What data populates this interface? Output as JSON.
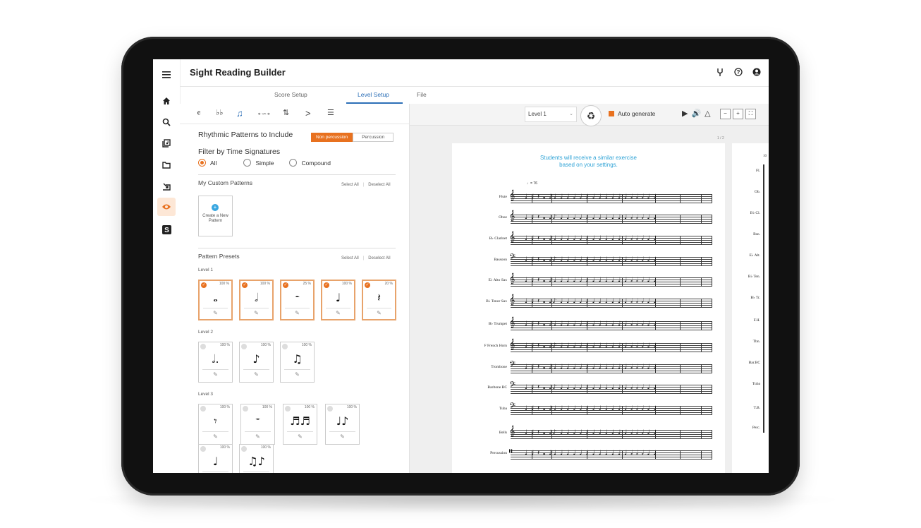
{
  "app": {
    "title": "Sight Reading Builder"
  },
  "rail": {
    "icons": [
      "menu-icon",
      "home-icon",
      "search-icon",
      "library-icon",
      "folder-icon",
      "assign-icon",
      "eye-icon",
      "s-logo-icon"
    ]
  },
  "header": {
    "icons": [
      "tuning-fork-icon",
      "help-icon",
      "account-icon"
    ]
  },
  "tabs": [
    {
      "label": "Score Setup"
    },
    {
      "label": "Level Setup",
      "active": true
    },
    {
      "label": "File"
    }
  ],
  "toolbar": {
    "icons": [
      "time-signature-icon",
      "key-signature-icon",
      "rhythm-icon",
      "melody-icon",
      "articulation-icon",
      "dynamics-icon",
      "settings-icon"
    ]
  },
  "rhythmic": {
    "title": "Rhythmic Patterns to Include",
    "segment": {
      "non_percussion": "Non percussion",
      "percussion": "Percussion"
    }
  },
  "filter": {
    "title": "Filter by Time Signatures",
    "options": [
      "All",
      "Simple",
      "Compound"
    ],
    "selected": "All"
  },
  "custom": {
    "title": "My Custom Patterns",
    "select_all": "Select All",
    "deselect_all": "Deselect All",
    "create_label": "Create a New Pattern"
  },
  "presets": {
    "title": "Pattern Presets",
    "select_all": "Select All",
    "deselect_all": "Deselect All",
    "levels": [
      {
        "label": "Level 1",
        "cards": [
          {
            "pct": "100 %",
            "note": "𝅝",
            "selected": true
          },
          {
            "pct": "100 %",
            "note": "𝅗𝅥",
            "selected": true
          },
          {
            "pct": "25 %",
            "note": "𝄼",
            "selected": true
          },
          {
            "pct": "100 %",
            "note": "♩",
            "selected": true
          },
          {
            "pct": "20 %",
            "note": "𝄽",
            "selected": true
          }
        ]
      },
      {
        "label": "Level 2",
        "cards": [
          {
            "pct": "100 %",
            "note": "𝅗𝅥.",
            "selected": false
          },
          {
            "pct": "100 %",
            "note": "♪",
            "selected": false
          },
          {
            "pct": "100 %",
            "note": "♫",
            "selected": false
          }
        ]
      },
      {
        "label": "Level 3",
        "cards": [
          {
            "pct": "100 %",
            "note": "𝄾",
            "selected": false
          },
          {
            "pct": "100 %",
            "note": "𝄻",
            "selected": false
          },
          {
            "pct": "100 %",
            "note": "♬♬",
            "selected": false
          },
          {
            "pct": "100 %",
            "note": "♩♪",
            "selected": false
          }
        ]
      },
      {
        "label": "",
        "cards": [
          {
            "pct": "100 %",
            "note": "♩",
            "selected": false
          },
          {
            "pct": "100 %",
            "note": "♫♪",
            "selected": false
          }
        ]
      }
    ]
  },
  "score_toolbar": {
    "level": "Level 1",
    "auto_generate": "Auto generate",
    "zoom": [
      "−",
      "+",
      "⛶"
    ]
  },
  "score": {
    "page_label": "1 / 2",
    "notice_line1": "Students will receive a similar exercise",
    "notice_line2": "based on your settings.",
    "tempo": "♩= 76",
    "instruments": [
      {
        "name": "Flute",
        "clef": "𝄞"
      },
      {
        "name": "Oboe",
        "clef": "𝄞"
      },
      {
        "name": "B♭ Clarinet",
        "clef": "𝄞"
      },
      {
        "name": "Bassoon",
        "clef": "𝄢"
      },
      {
        "name": "E♭ Alto Sax",
        "clef": "𝄞"
      },
      {
        "name": "B♭ Tenor Sax",
        "clef": "𝄞"
      },
      {
        "name": "B♭ Trumpet",
        "clef": "𝄞"
      },
      {
        "name": "F French Horn",
        "clef": "𝄞"
      },
      {
        "name": "Trombone",
        "clef": "𝄢"
      },
      {
        "name": "Baritone BC",
        "clef": "𝄢"
      },
      {
        "name": "Tuba",
        "clef": "𝄢"
      },
      {
        "name": "Bells",
        "clef": "𝄞"
      },
      {
        "name": "Percussion",
        "clef": "𝄥"
      }
    ],
    "page2_instruments": [
      "Fl.",
      "Ob.",
      "B♭ Cl.",
      "Bsn.",
      "E♭ Alt.",
      "B♭ Ten.",
      "B♭ Tr.",
      "F.H.",
      "Tbn.",
      "Bar.BC",
      "Tuba",
      "T.B.",
      "Perc."
    ],
    "page2_measure": "10"
  }
}
